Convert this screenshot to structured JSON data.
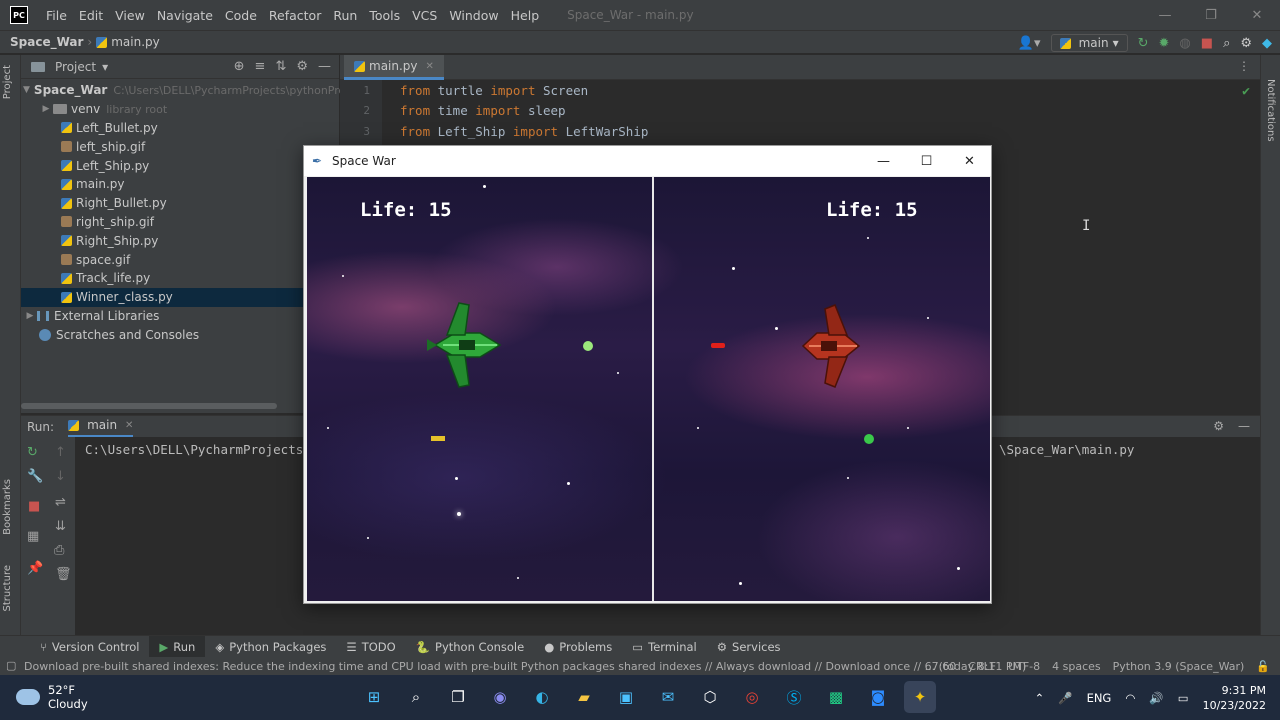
{
  "ide": {
    "title": "Space_War - main.py",
    "menu": [
      "File",
      "Edit",
      "View",
      "Navigate",
      "Code",
      "Refactor",
      "Run",
      "Tools",
      "VCS",
      "Window",
      "Help"
    ],
    "logo_text": "PC"
  },
  "nav": {
    "project": "Space_War",
    "file": "main.py",
    "run_config": "main"
  },
  "project_panel": {
    "title": "Project",
    "tree": [
      {
        "label": "Space_War",
        "extra": "C:\\Users\\DELL\\PycharmProjects\\pythonProj"
      },
      {
        "label": "venv",
        "extra": "library root"
      },
      {
        "label": "Left_Bullet.py"
      },
      {
        "label": "left_ship.gif"
      },
      {
        "label": "Left_Ship.py"
      },
      {
        "label": "main.py"
      },
      {
        "label": "Right_Bullet.py"
      },
      {
        "label": "right_ship.gif"
      },
      {
        "label": "Right_Ship.py"
      },
      {
        "label": "space.gif"
      },
      {
        "label": "Track_life.py"
      },
      {
        "label": "Winner_class.py"
      },
      {
        "label": "External Libraries"
      },
      {
        "label": "Scratches and Consoles"
      }
    ]
  },
  "stripes": {
    "project": "Project",
    "bookmarks": "Bookmarks",
    "structure": "Structure",
    "notifications": "Notifications"
  },
  "editor": {
    "tab": "main.py",
    "lines": [
      {
        "n": "1",
        "kw1": "from",
        "mod": " turtle ",
        "kw2": "import",
        "name": " Screen"
      },
      {
        "n": "2",
        "kw1": "from",
        "mod": " time ",
        "kw2": "import",
        "name": " sleep"
      },
      {
        "n": "3",
        "kw1": "from",
        "mod": " Left_Ship ",
        "kw2": "import",
        "name": " LeftWarShip"
      }
    ]
  },
  "run": {
    "label": "Run:",
    "tab": "main",
    "console_left": "C:\\Users\\DELL\\PycharmProjects",
    "console_right": "\\Space_War\\main.py"
  },
  "game": {
    "title": "Space War",
    "left_life": "Life: 15",
    "right_life": "Life: 15"
  },
  "tool_strip": [
    "Version Control",
    "Run",
    "Python Packages",
    "TODO",
    "Python Console",
    "Problems",
    "Terminal",
    "Services"
  ],
  "status": {
    "message": "Download pre-built shared indexes: Reduce the indexing time and CPU load with pre-built Python packages shared indexes // Always download // Download once // ... (today 8:11 PM)",
    "position": "67:60",
    "line_sep": "CRLF",
    "encoding": "UTF-8",
    "indent": "4 spaces",
    "interpreter": "Python 3.9 (Space_War)"
  },
  "taskbar": {
    "temp": "52°F",
    "weather": "Cloudy",
    "lang": "ENG",
    "time": "9:31 PM",
    "date": "10/23/2022"
  },
  "colors": {
    "keyword": "#cc7832",
    "accent": "#4a88c7",
    "left_ship": "#2fa83a",
    "right_ship": "#b5341f"
  }
}
